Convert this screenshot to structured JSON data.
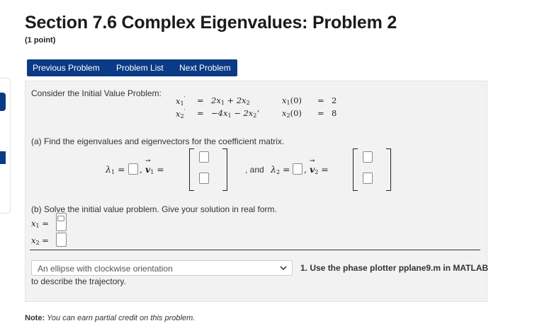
{
  "page": {
    "title": "Section 7.6 Complex Eigenvalues: Problem 2",
    "points": "(1 point)"
  },
  "nav": {
    "previous": "Previous Problem",
    "list": "Problem List",
    "next": "Next Problem"
  },
  "problem": {
    "intro": "Consider the Initial Value Problem:",
    "eq1_lhs": "x",
    "eq1_rhs_a": "2x",
    "eq1_rhs_b": " + 2x",
    "eq2_rhs_a": "−4x",
    "eq2_rhs_b": " − 2x",
    "ic1_value": "2",
    "ic2_value": "8",
    "equals": "=",
    "part_a": "(a) Find the eigenvalues and eigenvectors for the coefficient matrix.",
    "lambda1": "λ",
    "v1": "v",
    "and_text": ", and",
    "part_b": "(b) Solve the initial value problem. Give your solution in real form.",
    "x1": "x",
    "x2": "x",
    "select_value": "An ellipse with clockwise orientation",
    "select_hint": "1. Use the phase plotter pplane9.m in MATLAB",
    "select_tail": "to describe the trajectory."
  },
  "note": {
    "label": "Note:",
    "text": "You can earn partial credit on this problem."
  },
  "colors": {
    "nav_button": "#0b3a86",
    "panel_bg": "#f2f2f2"
  }
}
